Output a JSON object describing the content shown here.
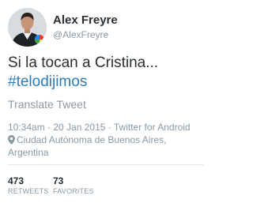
{
  "user": {
    "name": "Alex Freyre",
    "handle": "@AlexFreyre",
    "avatar_icon": "profile-photo"
  },
  "tweet": {
    "text": "Si la tocan a Cristina...",
    "hashtag": "#telodijimos",
    "translate_label": "Translate Tweet",
    "timestamp": "10:34am · 20 Jan 2015 · Twitter for Android",
    "location_icon": "map-pin-icon",
    "location": "Ciudad Autónoma de Buenos Aires, Argentina"
  },
  "stats": {
    "retweets": {
      "count": "473",
      "label": "RETWEETS"
    },
    "favorites": {
      "count": "73",
      "label": "FAVORITES"
    }
  },
  "colors": {
    "text": "#292f33",
    "muted": "#8899a6",
    "link": "#2b7bb9",
    "divider": "#e1e8ed"
  }
}
